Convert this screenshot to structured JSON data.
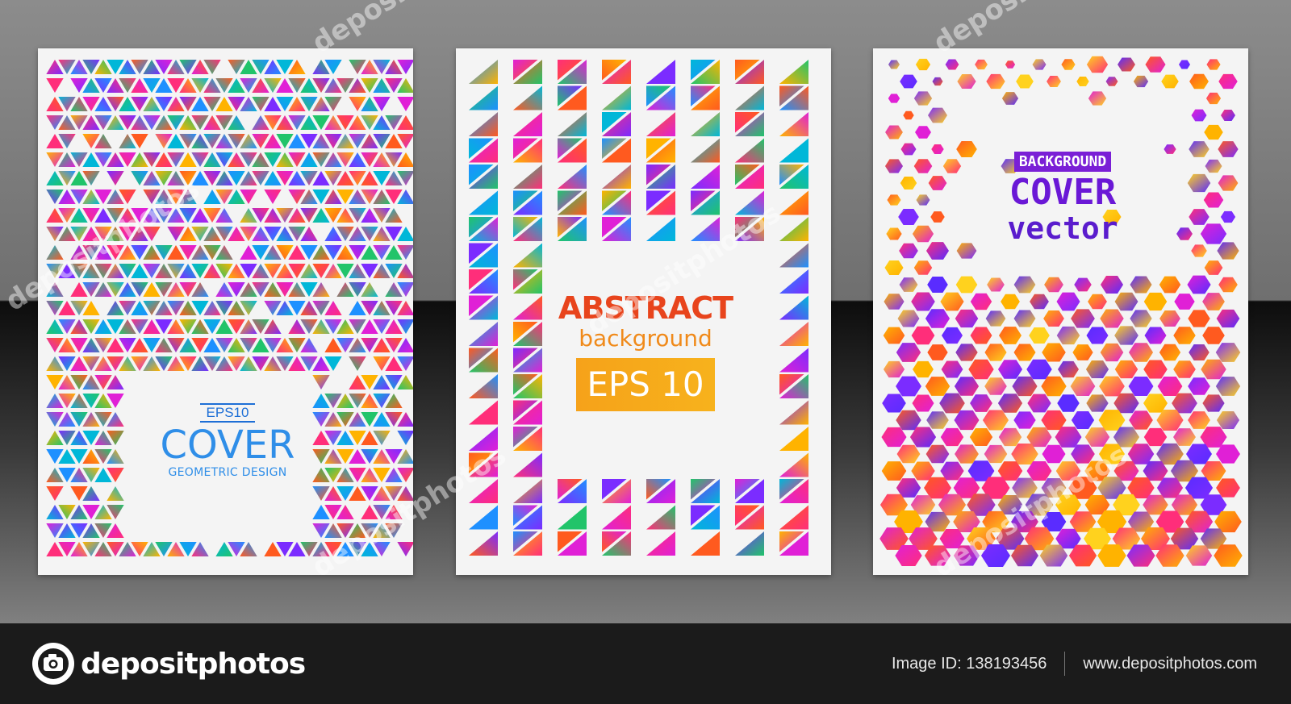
{
  "cards": [
    {
      "badge": "EPS10",
      "title": "COVER",
      "subtitle": "GEOMETRIC DESIGN",
      "pattern": "triangles"
    },
    {
      "title": "ABSTRACT",
      "subtitle": "background",
      "badge": "EPS 10",
      "pattern": "diagonal-triangles"
    },
    {
      "badge": "BACKGROUND",
      "title": "COVER",
      "subtitle": "vector",
      "pattern": "hexagons"
    }
  ],
  "footer": {
    "brand": "depositphotos",
    "image_id": "Image ID: 138193456",
    "website": "www.depositphotos.com"
  },
  "watermark": {
    "text": "depositphotos"
  },
  "colors": {
    "blue": "#2f8ee8",
    "orange": "#f08a1a",
    "red": "#e8441c",
    "purple": "#6a18d6",
    "eps_box": "#f6a21a"
  }
}
